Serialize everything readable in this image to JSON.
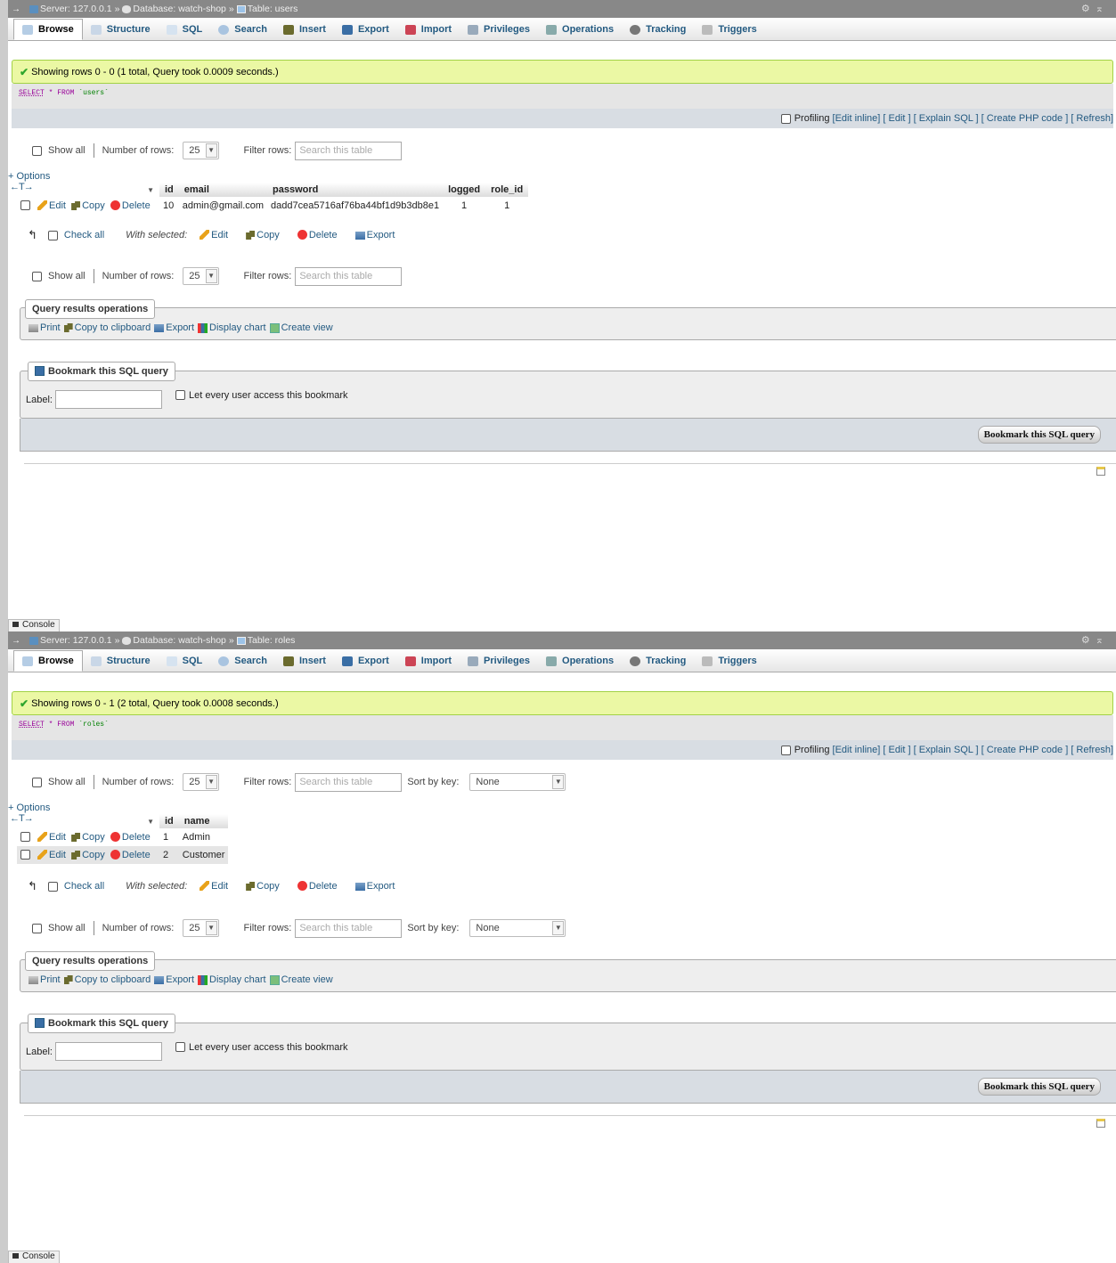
{
  "panes": [
    {
      "breadcrumb": {
        "server": "Server: 127.0.0.1",
        "database": "Database: watch-shop",
        "table": "Table: users"
      },
      "tabs": [
        "Browse",
        "Structure",
        "SQL",
        "Search",
        "Insert",
        "Export",
        "Import",
        "Privileges",
        "Operations",
        "Tracking",
        "Triggers"
      ],
      "message": "Showing rows 0 - 0 (1 total, Query took 0.0009 seconds.)",
      "sql": {
        "select": "SELECT",
        "star": "*",
        "from": "FROM",
        "table": "`users`"
      },
      "profiling": {
        "label": "Profiling",
        "links": "[Edit inline] [ Edit ] [ Explain SQL ] [ Create PHP code ] [ Refresh]"
      },
      "nav": {
        "show_all": "Show all",
        "num_rows_label": "Number of rows:",
        "num_rows": "25",
        "filter_label": "Filter rows:",
        "filter_placeholder": "Search this table"
      },
      "options_link": "+ Options",
      "columns": [
        "id",
        "email",
        "password",
        "logged",
        "role_id"
      ],
      "rows": [
        [
          "10",
          "admin@gmail.com",
          "dadd7cea5716af76ba44bf1d9b3db8e1",
          "1",
          "1"
        ]
      ],
      "row_actions": {
        "edit": "Edit",
        "copy": "Copy",
        "delete": "Delete"
      },
      "bulk": {
        "check_all": "Check all",
        "with_selected": "With selected:",
        "edit": "Edit",
        "copy": "Copy",
        "delete": "Delete",
        "export": "Export"
      },
      "qro": {
        "legend": "Query results operations",
        "print": "Print",
        "clipboard": "Copy to clipboard",
        "export": "Export",
        "chart": "Display chart",
        "view": "Create view"
      },
      "bookmark": {
        "legend": "Bookmark this SQL query",
        "label": "Label:",
        "every_user": "Let every user access this bookmark",
        "button": "Bookmark this SQL query"
      },
      "console": "Console"
    },
    {
      "breadcrumb": {
        "server": "Server: 127.0.0.1",
        "database": "Database: watch-shop",
        "table": "Table: roles"
      },
      "tabs": [
        "Browse",
        "Structure",
        "SQL",
        "Search",
        "Insert",
        "Export",
        "Import",
        "Privileges",
        "Operations",
        "Tracking",
        "Triggers"
      ],
      "message": "Showing rows 0 - 1 (2 total, Query took 0.0008 seconds.)",
      "sql": {
        "select": "SELECT",
        "star": "*",
        "from": "FROM",
        "table": "`roles`"
      },
      "profiling": {
        "label": "Profiling",
        "links": "[Edit inline] [ Edit ] [ Explain SQL ] [ Create PHP code ] [ Refresh]"
      },
      "nav": {
        "show_all": "Show all",
        "num_rows_label": "Number of rows:",
        "num_rows": "25",
        "filter_label": "Filter rows:",
        "filter_placeholder": "Search this table",
        "sort_label": "Sort by key:",
        "sort_value": "None"
      },
      "options_link": "+ Options",
      "columns": [
        "id",
        "name"
      ],
      "rows": [
        [
          "1",
          "Admin"
        ],
        [
          "2",
          "Customer"
        ]
      ],
      "row_actions": {
        "edit": "Edit",
        "copy": "Copy",
        "delete": "Delete"
      },
      "bulk": {
        "check_all": "Check all",
        "with_selected": "With selected:",
        "edit": "Edit",
        "copy": "Copy",
        "delete": "Delete",
        "export": "Export"
      },
      "qro": {
        "legend": "Query results operations",
        "print": "Print",
        "clipboard": "Copy to clipboard",
        "export": "Export",
        "chart": "Display chart",
        "view": "Create view"
      },
      "bookmark": {
        "legend": "Bookmark this SQL query",
        "label": "Label:",
        "every_user": "Let every user access this bookmark",
        "button": "Bookmark this SQL query"
      },
      "console": "Console"
    }
  ]
}
